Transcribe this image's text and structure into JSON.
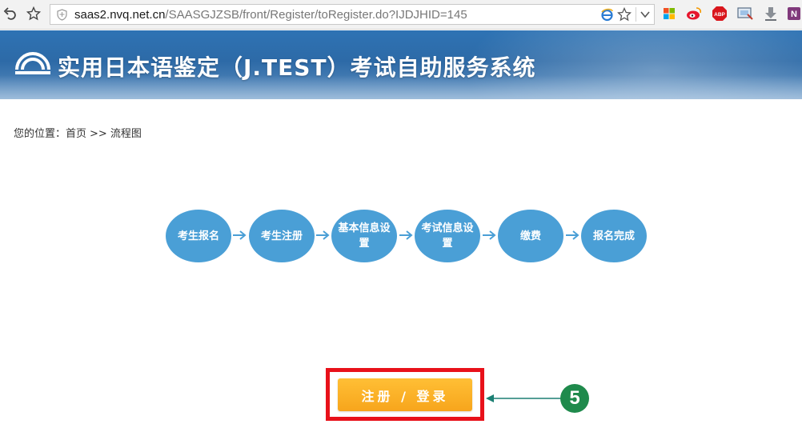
{
  "browser": {
    "url_host": "saas2.nvq.net.cn",
    "url_path": "/SAASGJZSB/front/Register/toRegister.do?IJDJHID=145",
    "extensions": [
      "windows-logo-icon",
      "weibo-icon",
      "adblock-icon",
      "screenshot-icon",
      "download-icon",
      "onenote-icon"
    ],
    "abp_label": "ABP",
    "onenote_label": "N"
  },
  "banner": {
    "title": "实用日本语鉴定（J.TEST）考试自助服务系统"
  },
  "breadcrumb": {
    "prefix": "您的位置：",
    "home": "首页",
    "separator": ">>",
    "current": "流程图"
  },
  "flow": {
    "steps": [
      {
        "label": "考生报名"
      },
      {
        "label": "考生注册"
      },
      {
        "label": "基本信息设置"
      },
      {
        "label": "考试信息设置"
      },
      {
        "label": "缴费"
      },
      {
        "label": "报名完成"
      }
    ]
  },
  "register": {
    "button_label": "注册 / 登录"
  },
  "annotation": {
    "step_number": "5"
  },
  "colors": {
    "step_fill": "#4a9fd6",
    "arrow": "#4a9fd6",
    "button": "#f7a51c",
    "highlight": "#e8111a",
    "badge": "#1f8a4c",
    "pointer": "#1b7f73"
  }
}
